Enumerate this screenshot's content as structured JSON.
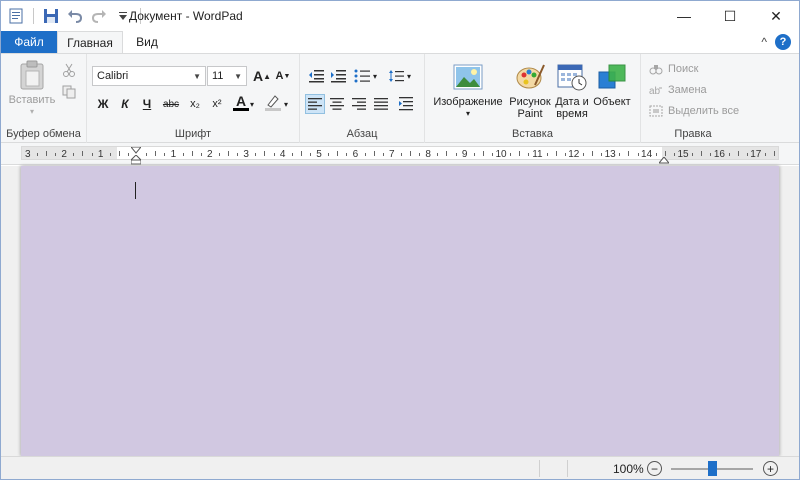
{
  "window": {
    "title": "Документ - WordPad",
    "controls": {
      "minimize": "—",
      "maximize": "☐",
      "close": "✕"
    }
  },
  "menu": {
    "file": "Файл",
    "tabs": [
      "Главная",
      "Вид"
    ],
    "collapse_glyph": "^",
    "help_glyph": "?"
  },
  "ribbon": {
    "clipboard": {
      "label": "Буфер обмена",
      "paste": "Вставить"
    },
    "font": {
      "label": "Шрифт",
      "family": "Calibri",
      "size": "11",
      "bold": "Ж",
      "italic": "К",
      "underline": "Ч",
      "strike": "abc",
      "subscript": "x₂",
      "superscript": "x²",
      "color_letter": "A"
    },
    "paragraph": {
      "label": "Абзац"
    },
    "insert": {
      "label": "Вставка",
      "image": "Изображение",
      "paint_l1": "Рисунок",
      "paint_l2": "Paint",
      "datetime_l1": "Дата и",
      "datetime_l2": "время",
      "object": "Объект"
    },
    "editing": {
      "label": "Правка",
      "find": "Поиск",
      "replace": "Замена",
      "select_all": "Выделить все"
    }
  },
  "ruler": {
    "numbers": [
      "3",
      "2",
      "1",
      "1",
      "2",
      "3",
      "4",
      "5",
      "6",
      "7",
      "8",
      "9",
      "10",
      "11",
      "12",
      "13",
      "14",
      "15",
      "16",
      "17"
    ]
  },
  "status": {
    "zoom": "100%",
    "zoom_out": "−",
    "zoom_in": "+",
    "zoom_level_fraction": 0.5
  },
  "colors": {
    "accent": "#1e6fc8",
    "page_bg": "#d1c8e1",
    "font_color_bar": "#000000",
    "highlight_bar": "#c8c8c8"
  }
}
